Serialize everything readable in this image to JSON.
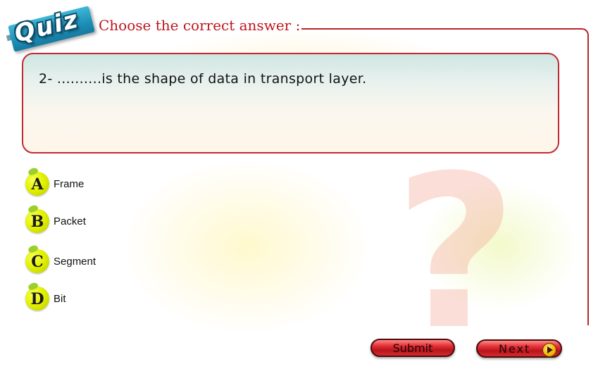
{
  "logo": {
    "text": "Quiz"
  },
  "header": {
    "title": "Choose the correct answer :"
  },
  "question": {
    "text": "2- ..........is the shape of data in transport layer."
  },
  "options": [
    {
      "letter": "A",
      "label": "Frame"
    },
    {
      "letter": "B",
      "label": "Packet"
    },
    {
      "letter": "C",
      "label": "Segment"
    },
    {
      "letter": "D",
      "label": "Bit"
    }
  ],
  "buttons": {
    "submit": "Submit",
    "next": "Next"
  },
  "watermark": {
    "glyph": "?"
  },
  "colors": {
    "accent": "#c0141c",
    "badge": "#e3f200",
    "button": "#d42a30",
    "logo": "#1d8fb8"
  }
}
